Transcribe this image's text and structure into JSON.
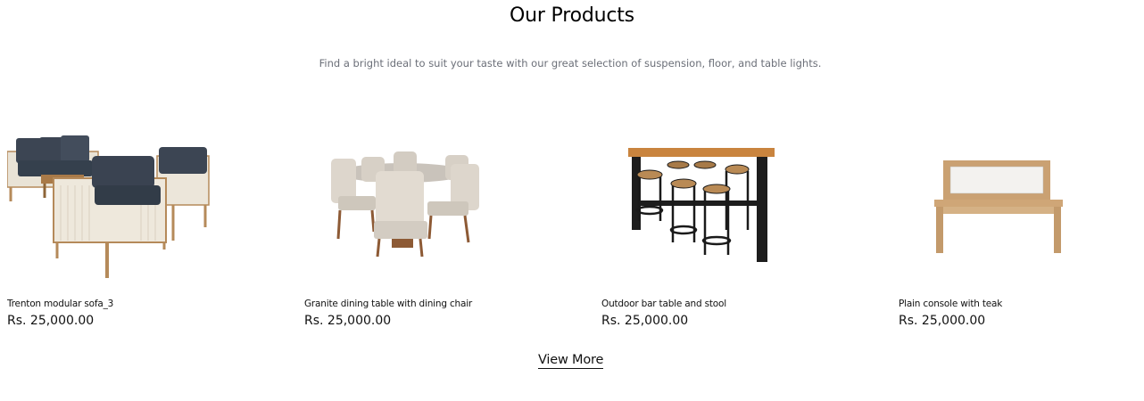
{
  "section": {
    "title": "Our Products",
    "subtitle": "Find a bright ideal to suit your taste with our great selection of suspension, floor, and table lights."
  },
  "products": [
    {
      "name": "Trenton modular sofa_3",
      "price": "Rs. 25,000.00",
      "image": "sofa-set-image"
    },
    {
      "name": "Granite dining table with dining chair",
      "price": "Rs. 25,000.00",
      "image": "dining-set-image"
    },
    {
      "name": "Outdoor bar table and stool",
      "price": "Rs. 25,000.00",
      "image": "bar-table-image"
    },
    {
      "name": "Plain console with teak",
      "price": "Rs. 25,000.00",
      "image": "console-table-image"
    }
  ],
  "actions": {
    "view_more_label": "View More"
  }
}
